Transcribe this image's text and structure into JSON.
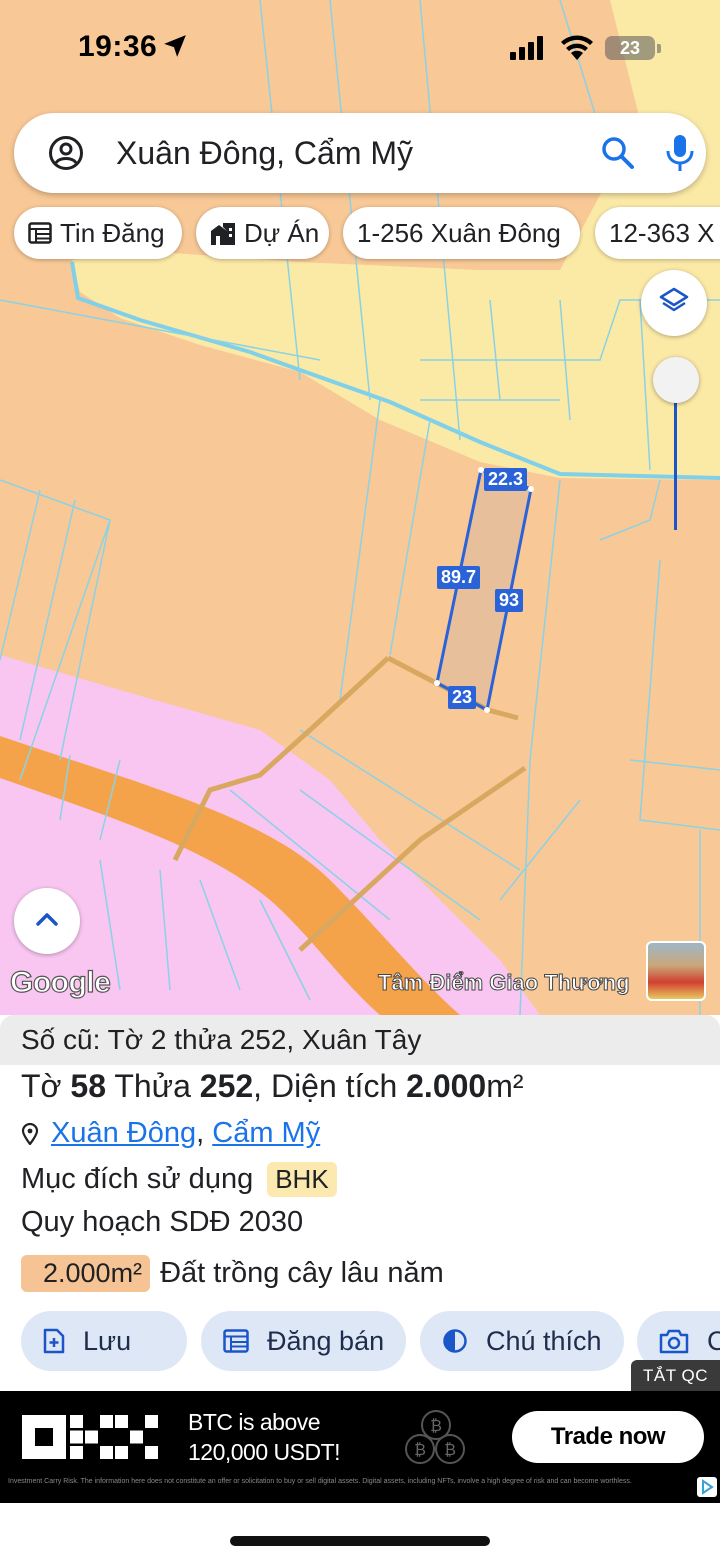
{
  "status_bar": {
    "time": "19:36",
    "battery": "23"
  },
  "search": {
    "value": "Xuân Đông, Cẩm Mỹ",
    "placeholder": ""
  },
  "chips": [
    {
      "label": "Tin Đăng",
      "icon": "listing-icon"
    },
    {
      "label": "Dự Án",
      "icon": "building-icon"
    },
    {
      "label": "1-256 Xuân Đông",
      "icon": ""
    },
    {
      "label": "12-363 X",
      "icon": ""
    }
  ],
  "map": {
    "parcel_edges": {
      "top": "22.3",
      "left": "89.7",
      "right": "93",
      "bottom": "23"
    },
    "attribution": "Google",
    "place_label": "Tâm Điểm Giao Thương",
    "colors": {
      "farmland": "#f8c896",
      "residential": "#fbe9a6",
      "special_zone": "#f8c6f0",
      "road": "#f5a34a",
      "parcel_line": "#8ad2e6",
      "selection": "#2a62d8"
    }
  },
  "info": {
    "old_ref": "Số cũ: Tờ 2 thửa 252, Xuân Tây",
    "title_prefix": "Tờ ",
    "sheet_no": "58",
    "title_mid": " Thửa ",
    "parcel_no": "252",
    "title_area_label": ", Diện tích ",
    "area_value": "2.000",
    "area_unit": "m²",
    "commune": "Xuân Đông",
    "separator": ", ",
    "district": "Cẩm Mỹ",
    "purpose_label": "Mục đích sử dụng",
    "purpose_code": "BHK",
    "plan_label": "Quy hoạch SDĐ 2030",
    "plan_area": "2.000m²",
    "plan_desc": "Đất trồng cây lâu năm"
  },
  "actions": [
    {
      "label": "Lưu",
      "icon": "save-icon"
    },
    {
      "label": "Đăng bán",
      "icon": "post-sale-icon"
    },
    {
      "label": "Chú thích",
      "icon": "legend-icon"
    },
    {
      "label": "C",
      "icon": "camera-icon"
    }
  ],
  "ad": {
    "close_label": "TẮT QC",
    "brand": "OKX",
    "line1": "BTC is above",
    "line2": "120,000 USDT!",
    "cta": "Trade now",
    "disclaimer": "Investment Carry Risk. The information here does not constitute an offer or solicitation to buy or sell digital assets. Digital assets, including NFTs, involve a high degree of risk and can become worthless."
  }
}
